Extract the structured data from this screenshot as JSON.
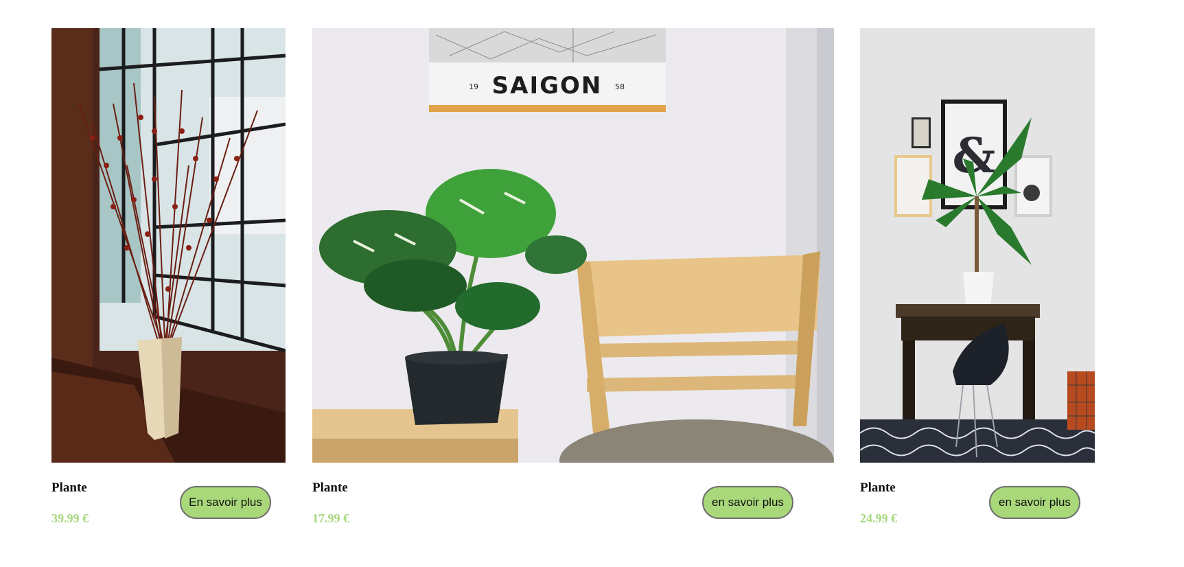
{
  "products": [
    {
      "name": "Plante",
      "price": "39.99 €",
      "button_label": "En savoir plus",
      "image_subject": "red pussy-willow branches in a cream vase by a window"
    },
    {
      "name": "Plante",
      "price": "17.99 €",
      "button_label": "en savoir plus",
      "image_subject": "monstera plant in black pot beside wooden chair",
      "poster_text": "SAIGON",
      "poster_year_left": "19",
      "poster_year_right": "58"
    },
    {
      "name": "Plante",
      "price": "24.99 €",
      "button_label": "en savoir plus",
      "image_subject": "palm in white pot on dark desk with black chair",
      "frame_glyph": "&"
    }
  ],
  "colors": {
    "price": "#a6d77e",
    "button_bg": "#a9d87a",
    "button_border": "#6e6e6e"
  }
}
